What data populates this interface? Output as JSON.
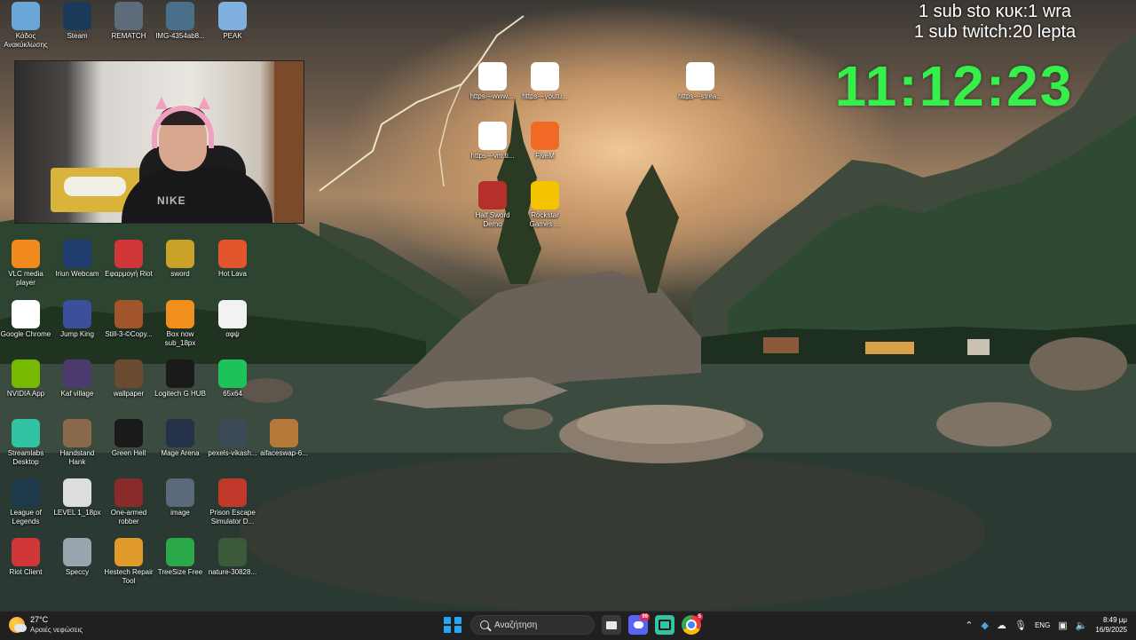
{
  "desktop_icons": [
    {
      "label": "Κάδος Ανακύκλωσης",
      "icon": "recycle-bin-icon",
      "color": "#6aa7d8"
    },
    {
      "label": "Steam",
      "icon": "steam-icon",
      "color": "#1b3a5a"
    },
    {
      "label": "REMATCH",
      "icon": "rematch-icon",
      "color": "#5d6b7a"
    },
    {
      "label": "IMG-4354ab8...",
      "icon": "image-file-icon",
      "color": "#4a6f8a"
    },
    {
      "label": "PEAK",
      "icon": "peak-icon",
      "color": "#7fb0e0"
    },
    {
      "label": "https---www....",
      "icon": "chrome-shortcut-icon",
      "color": "#ffffff"
    },
    {
      "label": "https---youtu...",
      "icon": "chrome-shortcut-icon",
      "color": "#ffffff"
    },
    {
      "label": "https---strea...",
      "icon": "chrome-shortcut-icon",
      "color": "#ffffff"
    },
    {
      "label": "https---vm.ti...",
      "icon": "chrome-shortcut-icon",
      "color": "#ffffff"
    },
    {
      "label": "FiveM",
      "icon": "fivem-icon",
      "color": "#f06a25"
    },
    {
      "label": "Half Sword Demo",
      "icon": "half-sword-icon",
      "color": "#b5302a"
    },
    {
      "label": "Rockstar Games ...",
      "icon": "rockstar-icon",
      "color": "#f5c400"
    },
    {
      "label": "VLC media player",
      "icon": "vlc-icon",
      "color": "#f08a1c"
    },
    {
      "label": "Iriun Webcam",
      "icon": "iriun-webcam-icon",
      "color": "#1e3c6e"
    },
    {
      "label": "Εφαρμογή Riot",
      "icon": "riot-icon",
      "color": "#d13639"
    },
    {
      "label": "sword",
      "icon": "sword-icon",
      "color": "#c9a227"
    },
    {
      "label": "Hot Lava",
      "icon": "hot-lava-icon",
      "color": "#e2542b"
    },
    {
      "label": "Google Chrome",
      "icon": "chrome-icon",
      "color": "#ffffff"
    },
    {
      "label": "Jump King",
      "icon": "jump-king-icon",
      "color": "#3b4f9b"
    },
    {
      "label": "Still-3-©Copy...",
      "icon": "image-file-icon",
      "color": "#a2542a"
    },
    {
      "label": "Box now sub_18px",
      "icon": "image-file-icon",
      "color": "#f08f1c"
    },
    {
      "label": "αφψ",
      "icon": "text-file-icon",
      "color": "#f2f2f2"
    },
    {
      "label": "NVIDIA App",
      "icon": "nvidia-icon",
      "color": "#76b900"
    },
    {
      "label": "Kaf village",
      "icon": "image-file-icon",
      "color": "#4b3a6b"
    },
    {
      "label": "wallpaper",
      "icon": "image-file-icon",
      "color": "#6a4a30"
    },
    {
      "label": "Logitech G HUB",
      "icon": "logitech-icon",
      "color": "#1a1a1a"
    },
    {
      "label": "65x64",
      "icon": "image-file-icon",
      "color": "#1ec25b"
    },
    {
      "label": "Streamlabs Desktop",
      "icon": "streamlabs-icon",
      "color": "#31c3a2"
    },
    {
      "label": "Handstand Hank",
      "icon": "handstand-hank-icon",
      "color": "#8a6a4a"
    },
    {
      "label": "Green Hell",
      "icon": "green-hell-icon",
      "color": "#1a1a1a"
    },
    {
      "label": "Mage Arena",
      "icon": "mage-arena-icon",
      "color": "#26324a"
    },
    {
      "label": "pexels-vikash...",
      "icon": "image-file-icon",
      "color": "#3c4a55"
    },
    {
      "label": "aifaceswap-6...",
      "icon": "image-file-icon",
      "color": "#b57a3a"
    },
    {
      "label": "League of Legends",
      "icon": "league-icon",
      "color": "#1c3a4a"
    },
    {
      "label": "LEVEL 1_18px",
      "icon": "image-file-icon",
      "color": "#dddddd"
    },
    {
      "label": "One-armed robber",
      "icon": "one-armed-robber-icon",
      "color": "#8a2a2a"
    },
    {
      "label": "image",
      "icon": "image-file-icon",
      "color": "#5a6a7a"
    },
    {
      "label": "Prison Escape Simulator D...",
      "icon": "prison-escape-icon",
      "color": "#c0392b"
    },
    {
      "label": "Riot Client",
      "icon": "riot-client-icon",
      "color": "#d13639"
    },
    {
      "label": "Speccy",
      "icon": "speccy-icon",
      "color": "#9aa4ae"
    },
    {
      "label": "Hestech Repair Tool",
      "icon": "repair-tool-icon",
      "color": "#e09a2a"
    },
    {
      "label": "TreeSize Free",
      "icon": "treesize-icon",
      "color": "#2aa84a"
    },
    {
      "label": "nature-30828...",
      "icon": "image-file-icon",
      "color": "#3a5a3a"
    }
  ],
  "overlay": {
    "sub_line_1": "1 sub sto κυκ:1 wra",
    "sub_line_2": "1 sub twitch:20 lepta",
    "clock": "11:12:23",
    "clock_color": "#35f04a",
    "webcam_brand": "NIKE"
  },
  "taskbar": {
    "weather_temp": "27°C",
    "weather_desc": "Αραιές νεφώσεις",
    "search_placeholder": "Αναζήτηση",
    "discord_badge": "99",
    "chrome_badge": "5",
    "language": "ENG",
    "time": "8:49 μμ",
    "date": "16/9/2025"
  }
}
